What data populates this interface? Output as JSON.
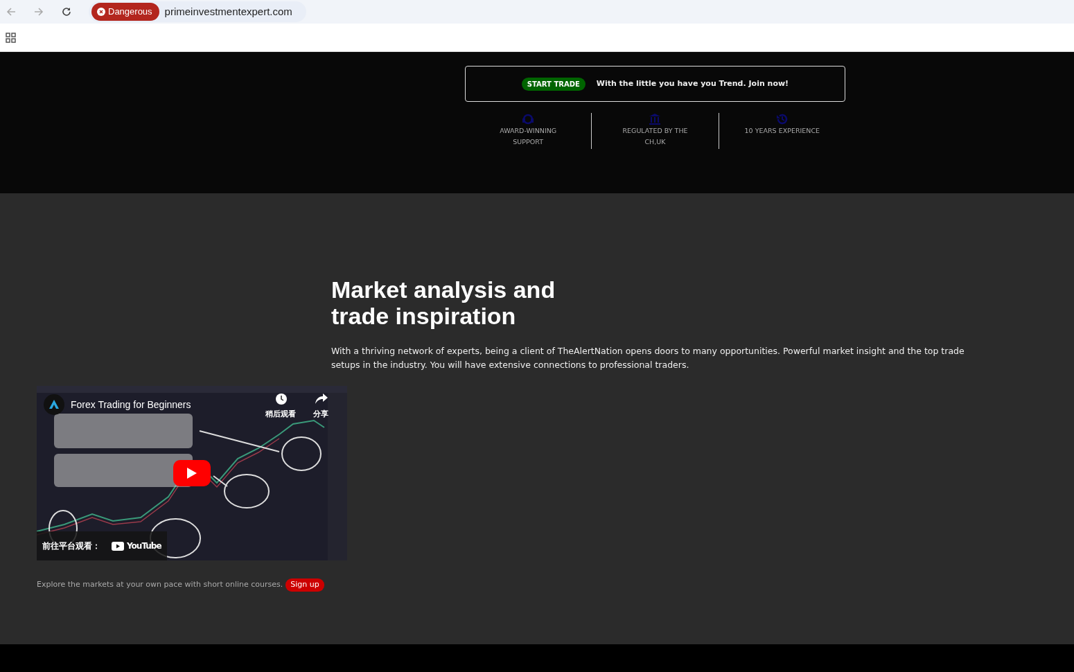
{
  "browser": {
    "security_label": "Dangerous",
    "url": "primeinvestmentexpert.com"
  },
  "promo": {
    "button": "START TRADE",
    "text": "With the little you have you Trend. Join now!"
  },
  "features": [
    {
      "kind": "support",
      "label": "AWARD-WINNING SUPPORT"
    },
    {
      "kind": "bank",
      "label": "REGULATED BY THE CH,UK"
    },
    {
      "kind": "history",
      "label": "10 YEARS EXPERIENCE"
    }
  ],
  "section": {
    "heading": "Market analysis and trade inspiration",
    "body": "With a thriving network of experts, being a client of TheAlertNation opens doors to many opportunities. Powerful market insight and the top trade setups in the industry. You will have extensive connections to professional traders."
  },
  "video": {
    "title": "Forex Trading for Beginners",
    "watch_later": "稍后观看",
    "share": "分享",
    "watch_on": "前往平台观看：",
    "platform": "YouTube"
  },
  "courses": {
    "text": "Explore the markets at your own pace with short online courses.",
    "button": "Sign up"
  }
}
